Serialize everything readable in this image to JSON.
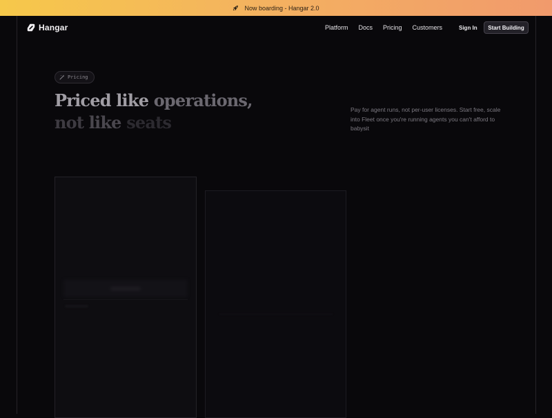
{
  "banner": {
    "text": "Now boarding - Hangar 2.0",
    "icon": "rocket-icon"
  },
  "brand": {
    "name": "Hangar",
    "icon": "hangar-logo-icon"
  },
  "nav": {
    "links": [
      "Platform",
      "Docs",
      "Pricing",
      "Customers"
    ],
    "sign_in": "Sign In",
    "cta": "Start Building"
  },
  "hero": {
    "badge": {
      "label": "Pricing",
      "icon": "sparkle-icon"
    },
    "headline": {
      "line1": {
        "a": "Priced like ",
        "b": "operations,"
      },
      "line2": {
        "a": "not ",
        "b": "like ",
        "c": "seats"
      }
    },
    "lede": "Pay for agent runs, not per-user licenses. Start free, scale into Fleet once you're running agents you can't afford to babysit"
  },
  "colors": {
    "banner_start": "#f6c84a",
    "banner_end": "#f19a6c",
    "background": "#09080b"
  }
}
